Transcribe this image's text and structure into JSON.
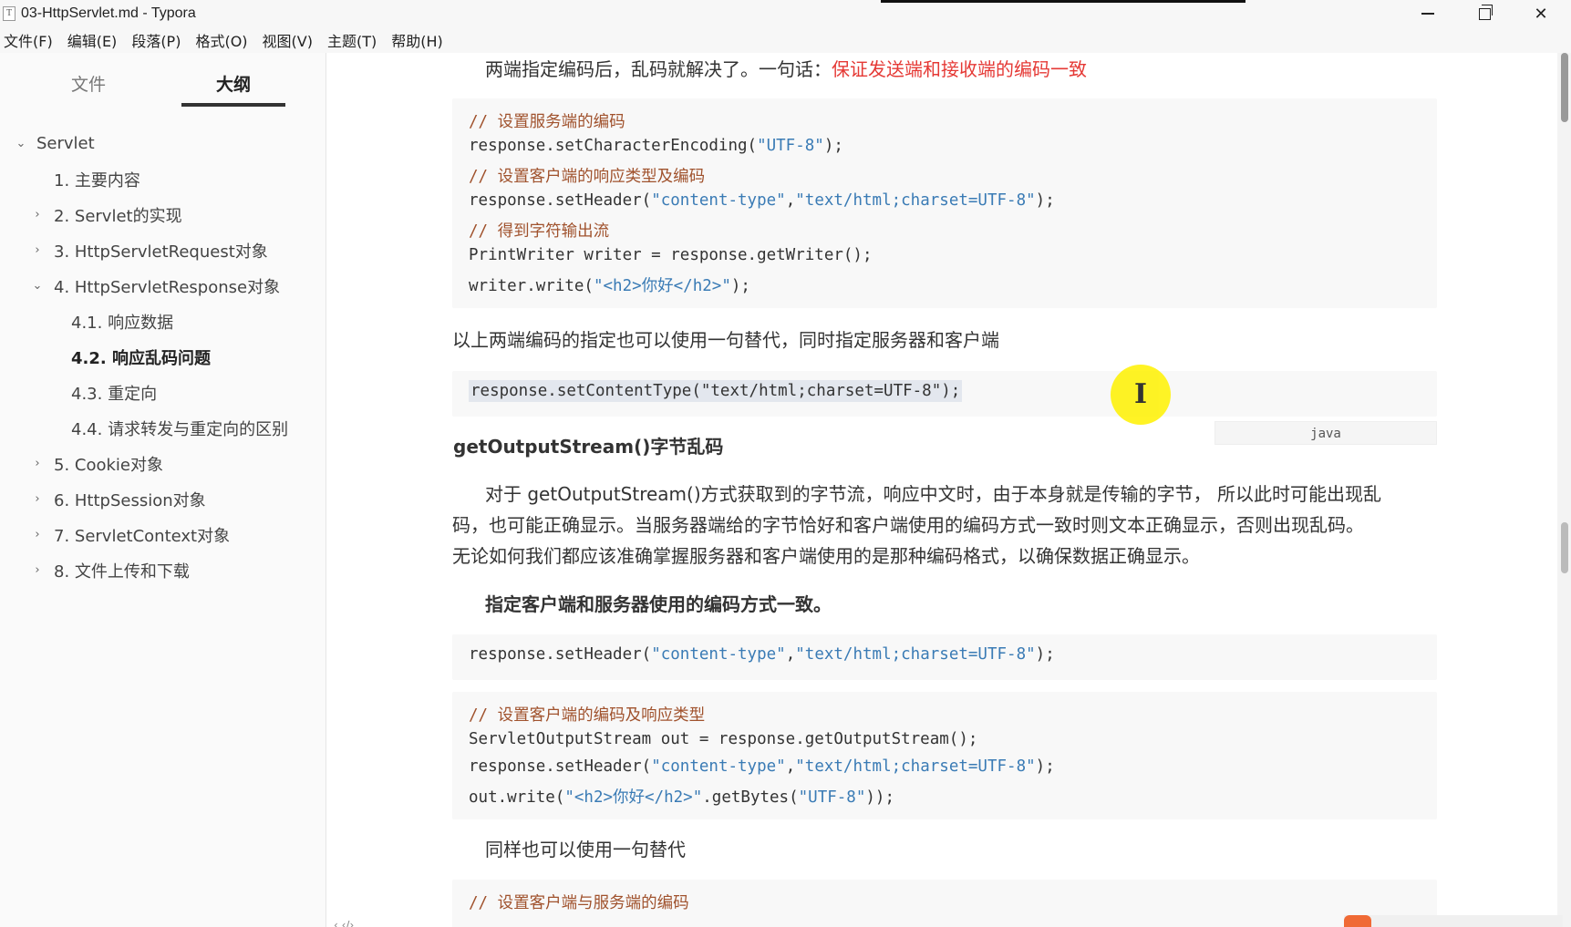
{
  "window": {
    "title": "03-HttpServlet.md - Typora",
    "app_icon": "T"
  },
  "menu": [
    "文件(F)",
    "编辑(E)",
    "段落(P)",
    "格式(O)",
    "视图(V)",
    "主题(T)",
    "帮助(H)"
  ],
  "sidebar": {
    "tabs": [
      "文件",
      "大纲"
    ],
    "active_tab": "大纲",
    "outline": [
      {
        "label": "Servlet",
        "expanded": true
      },
      {
        "label": "1. 主要内容"
      },
      {
        "label": "2. Servlet的实现",
        "collapsed": true
      },
      {
        "label": "3. HttpServletRequest对象",
        "collapsed": true
      },
      {
        "label": "4. HttpServletResponse对象",
        "expanded": true
      },
      {
        "label": "4.1. 响应数据"
      },
      {
        "label": "4.2. 响应乱码问题",
        "active": true
      },
      {
        "label": "4.3. 重定向"
      },
      {
        "label": "4.4. 请求转发与重定向的区别"
      },
      {
        "label": "5. Cookie对象",
        "collapsed": true
      },
      {
        "label": "6. HttpSession对象",
        "collapsed": true
      },
      {
        "label": "7. ServletContext对象",
        "collapsed": true
      },
      {
        "label": "8. 文件上传和下载",
        "collapsed": true
      }
    ]
  },
  "doc": {
    "p1_text": "两端指定编码后，乱码就解决了。一句话：",
    "p1_red": "保证发送端和接收端的编码一致",
    "code1": {
      "c1": "// 设置服务端的编码",
      "l2a": "response.setCharacterEncoding(",
      "l2s": "\"UTF-8\"",
      "l2b": ");",
      "c3": "// 设置客户端的响应类型及编码",
      "l4a": "response.setHeader(",
      "l4s1": "\"content-type\"",
      "l4m": ",",
      "l4s2": "\"text/html;charset=UTF-8\"",
      "l4b": ");",
      "c5": "// 得到字符输出流",
      "l6": "PrintWriter writer = response.getWriter();",
      "l7a": "writer.write(",
      "l7s": "\"<h2>你好</h2>\"",
      "l7b": ");"
    },
    "p2": "以上两端编码的指定也可以使用一句替代，同时指定服务器和客户端",
    "code2_line": "response.setContentType(\"text/html;charset=UTF-8\");",
    "code2_lang": "java",
    "h_stream": "getOutputStream()字节乱码",
    "p3_l1": "对于 getOutputStream()方式获取到的字节流，响应中文时，由于本身就是传输的字节， 所以此时可能出现乱",
    "p3_l2": "码，也可能正确显示。当服务器端给的字节恰好和客户端使用的编码方式一致时则文本正确显示，否则出现乱码。",
    "p3_l3": "无论如何我们都应该准确掌握服务器和客户端使用的是那种编码格式，以确保数据正确显示。",
    "p4_bold": "指定客户端和服务器使用的编码方式一致。",
    "code3": {
      "a": "response.setHeader(",
      "s1": "\"content-type\"",
      "m": ",",
      "s2": "\"text/html;charset=UTF-8\"",
      "b": ");"
    },
    "code4": {
      "c1": "// 设置客户端的编码及响应类型",
      "l2": "ServletOutputStream out = response.getOutputStream();",
      "l3a": "response.setHeader(",
      "l3s1": "\"content-type\"",
      "l3m": ",",
      "l3s2": "\"text/html;charset=UTF-8\"",
      "l3b": ");",
      "l4a": "out.write(",
      "l4s1": "\"<h2>你好</h2>\"",
      "l4m": ".getBytes(",
      "l4s2": "\"UTF-8\"",
      "l4b": "));"
    },
    "p5": "同样也可以使用一句替代",
    "code5_c1": "// 设置客户端与服务端的编码"
  },
  "colors": {
    "comment": "#a0522d",
    "string": "#3a7bb5",
    "highlight_red": "#e53935",
    "cursor_highlight": "#fff200"
  }
}
